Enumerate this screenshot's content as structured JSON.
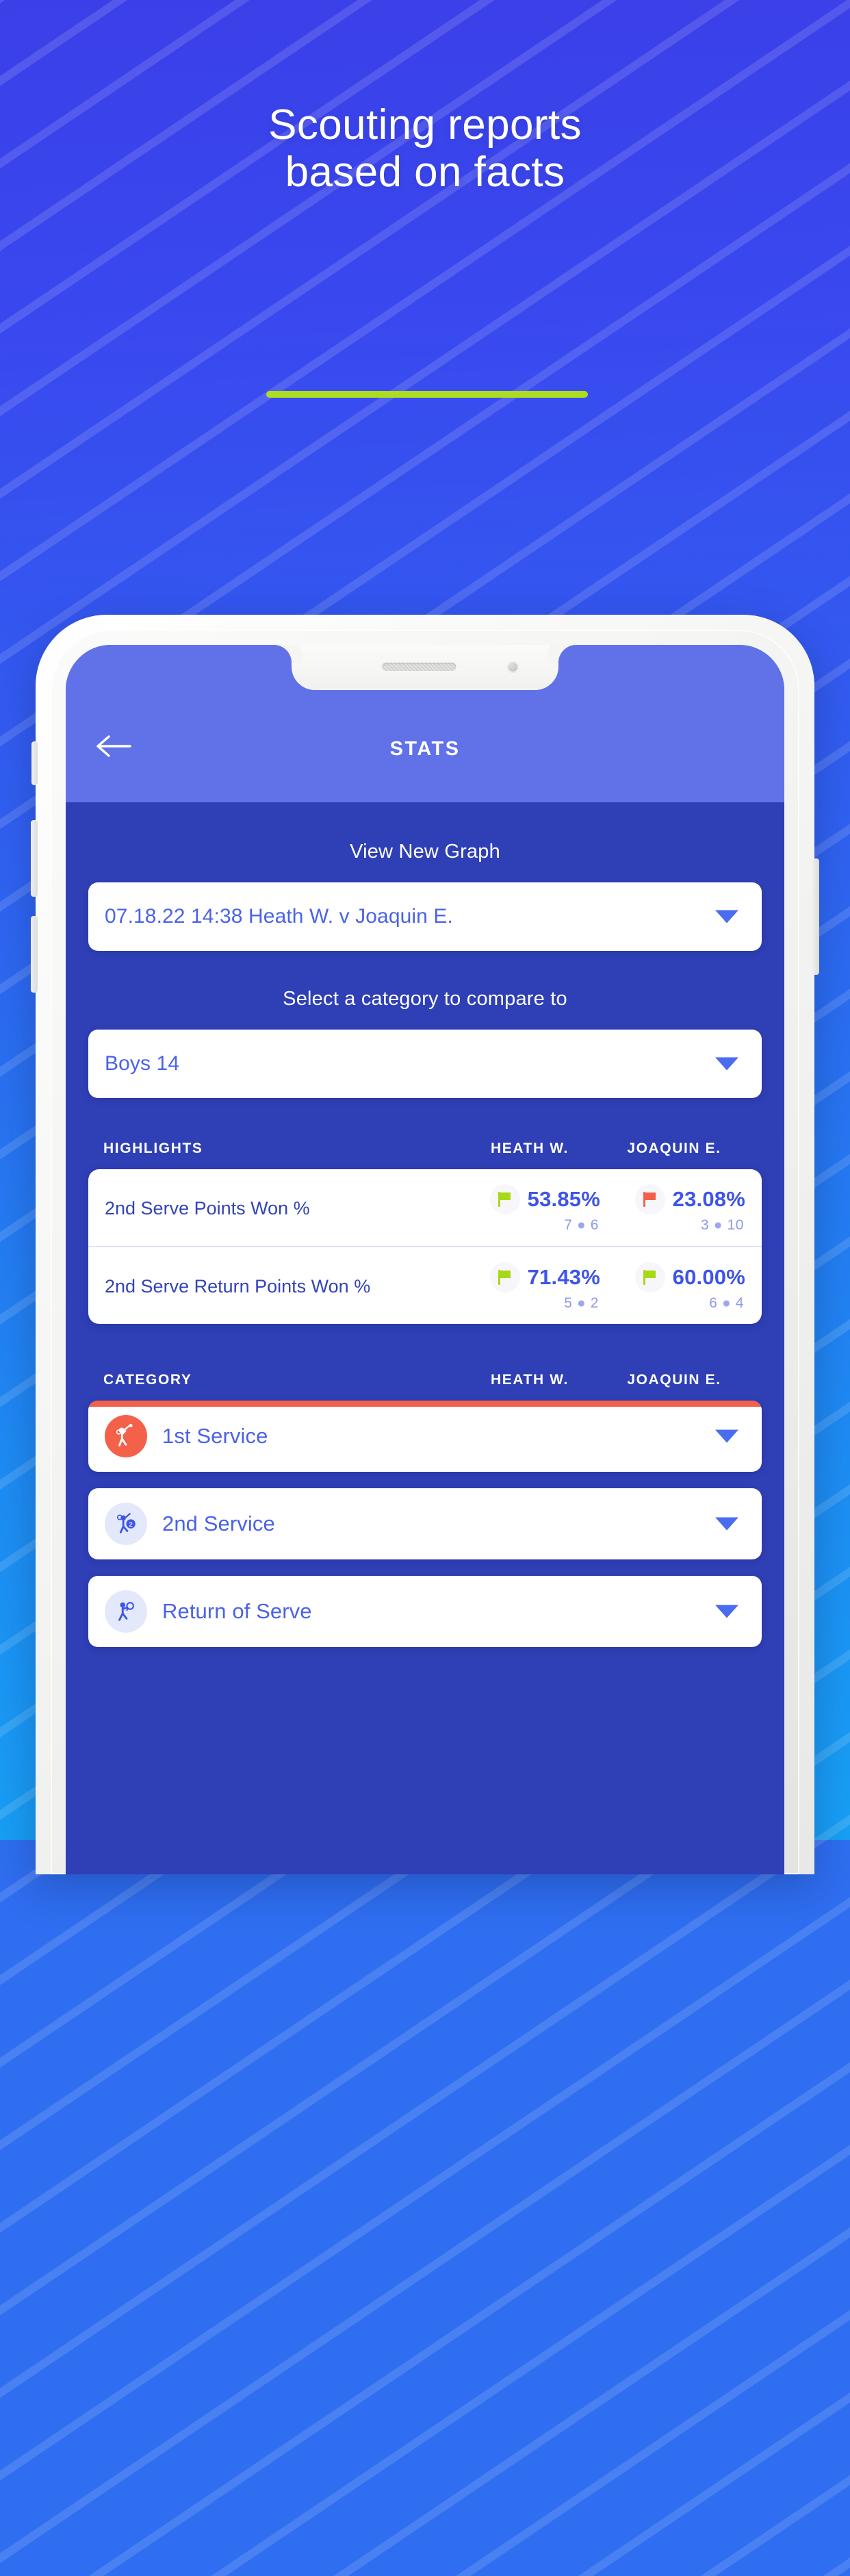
{
  "hero": {
    "headline_line1": "Scouting reports",
    "headline_line2": "based on facts",
    "rule_color": "#aedc1f"
  },
  "phone": {
    "nav": {
      "back_icon": "arrow-left-icon",
      "title": "STATS"
    },
    "labels": {
      "view_graph": "View New Graph",
      "select_category": "Select a category to compare to"
    },
    "match_select": {
      "value": "07.18.22 14:38 Heath W. v Joaquin E.",
      "caret_icon": "chevron-down-icon"
    },
    "category_select": {
      "value": "Boys 14",
      "caret_icon": "chevron-down-icon"
    },
    "highlights_header": {
      "category": "HIGHLIGHTS",
      "player1": "HEATH W.",
      "player2": "JOAQUIN E."
    },
    "highlights": [
      {
        "name": "2nd Serve Points Won %",
        "p1": {
          "flag": "flag-green-icon",
          "pct": "53.85%",
          "sub_a": "7",
          "sub_b": "6"
        },
        "p2": {
          "flag": "flag-red-icon",
          "pct": "23.08%",
          "sub_a": "3",
          "sub_b": "10"
        }
      },
      {
        "name": "2nd Serve Return Points Won %",
        "p1": {
          "flag": "flag-green-icon",
          "pct": "71.43%",
          "sub_a": "5",
          "sub_b": "2"
        },
        "p2": {
          "flag": "flag-green-icon",
          "pct": "60.00%",
          "sub_a": "6",
          "sub_b": "4"
        }
      }
    ],
    "category_header": {
      "category": "CATEGORY",
      "player1": "HEATH W.",
      "player2": "JOAQUIN E."
    },
    "categories": [
      {
        "label": "1st Service",
        "icon": "tennis-serve-icon",
        "accent": true
      },
      {
        "label": "2nd Service",
        "icon": "tennis-serve-2-icon",
        "accent": false
      },
      {
        "label": "Return of Serve",
        "icon": "tennis-return-icon",
        "accent": false
      }
    ],
    "colors": {
      "accent_orange": "#f4614a",
      "accent_green": "#a6d916",
      "brand_blue": "#4a62e8",
      "screen_blue": "#2f3fb5",
      "nav_blue": "#6172e8"
    }
  }
}
